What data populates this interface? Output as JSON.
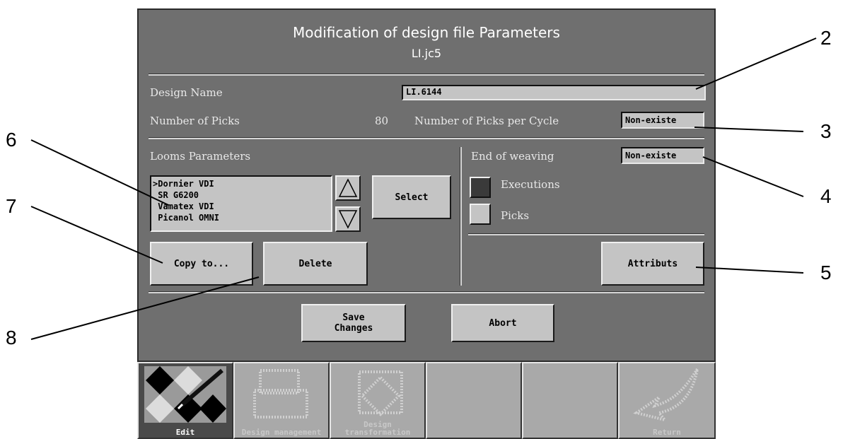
{
  "dialog": {
    "title": "Modification of design file Parameters",
    "filename": "LI.jc5"
  },
  "design_name": {
    "label": "Design Name",
    "value": "LI.6144"
  },
  "number_of_picks": {
    "label": "Number of Picks",
    "value": "80"
  },
  "picks_per_cycle": {
    "label": "Number of Picks per Cycle",
    "value": "Non-existe"
  },
  "looms": {
    "label": "Looms Parameters",
    "items": [
      ">Dornier VDI",
      " SR G6200",
      " Vamatex VDI",
      " Picanol OMNI"
    ],
    "select_label": "Select",
    "copy_label": "Copy to...",
    "delete_label": "Delete"
  },
  "end_of_weaving": {
    "label": "End of weaving",
    "value": "Non-existe",
    "options": [
      {
        "label": "Executions",
        "selected": true
      },
      {
        "label": "Picks",
        "selected": false
      }
    ],
    "attributes_label": "Attributs"
  },
  "actions": {
    "save_label": "Save\nChanges",
    "abort_label": "Abort"
  },
  "toolbar": [
    {
      "label": "Edit",
      "icon": "edit-pattern-icon",
      "enabled": true
    },
    {
      "label": "Design management",
      "icon": "design-management-icon",
      "enabled": false
    },
    {
      "label": "Design transformation",
      "icon": "design-transformation-icon",
      "enabled": false
    },
    {
      "label": "",
      "icon": "",
      "enabled": false
    },
    {
      "label": "",
      "icon": "",
      "enabled": false
    },
    {
      "label": "Return",
      "icon": "return-arrow-icon",
      "enabled": false
    }
  ],
  "callouts": [
    "2",
    "3",
    "4",
    "5",
    "6",
    "7",
    "8"
  ],
  "colors": {
    "panel": "#6f6f6f",
    "control": "#c4c4c4",
    "selected_check": "#3a3a3a"
  }
}
